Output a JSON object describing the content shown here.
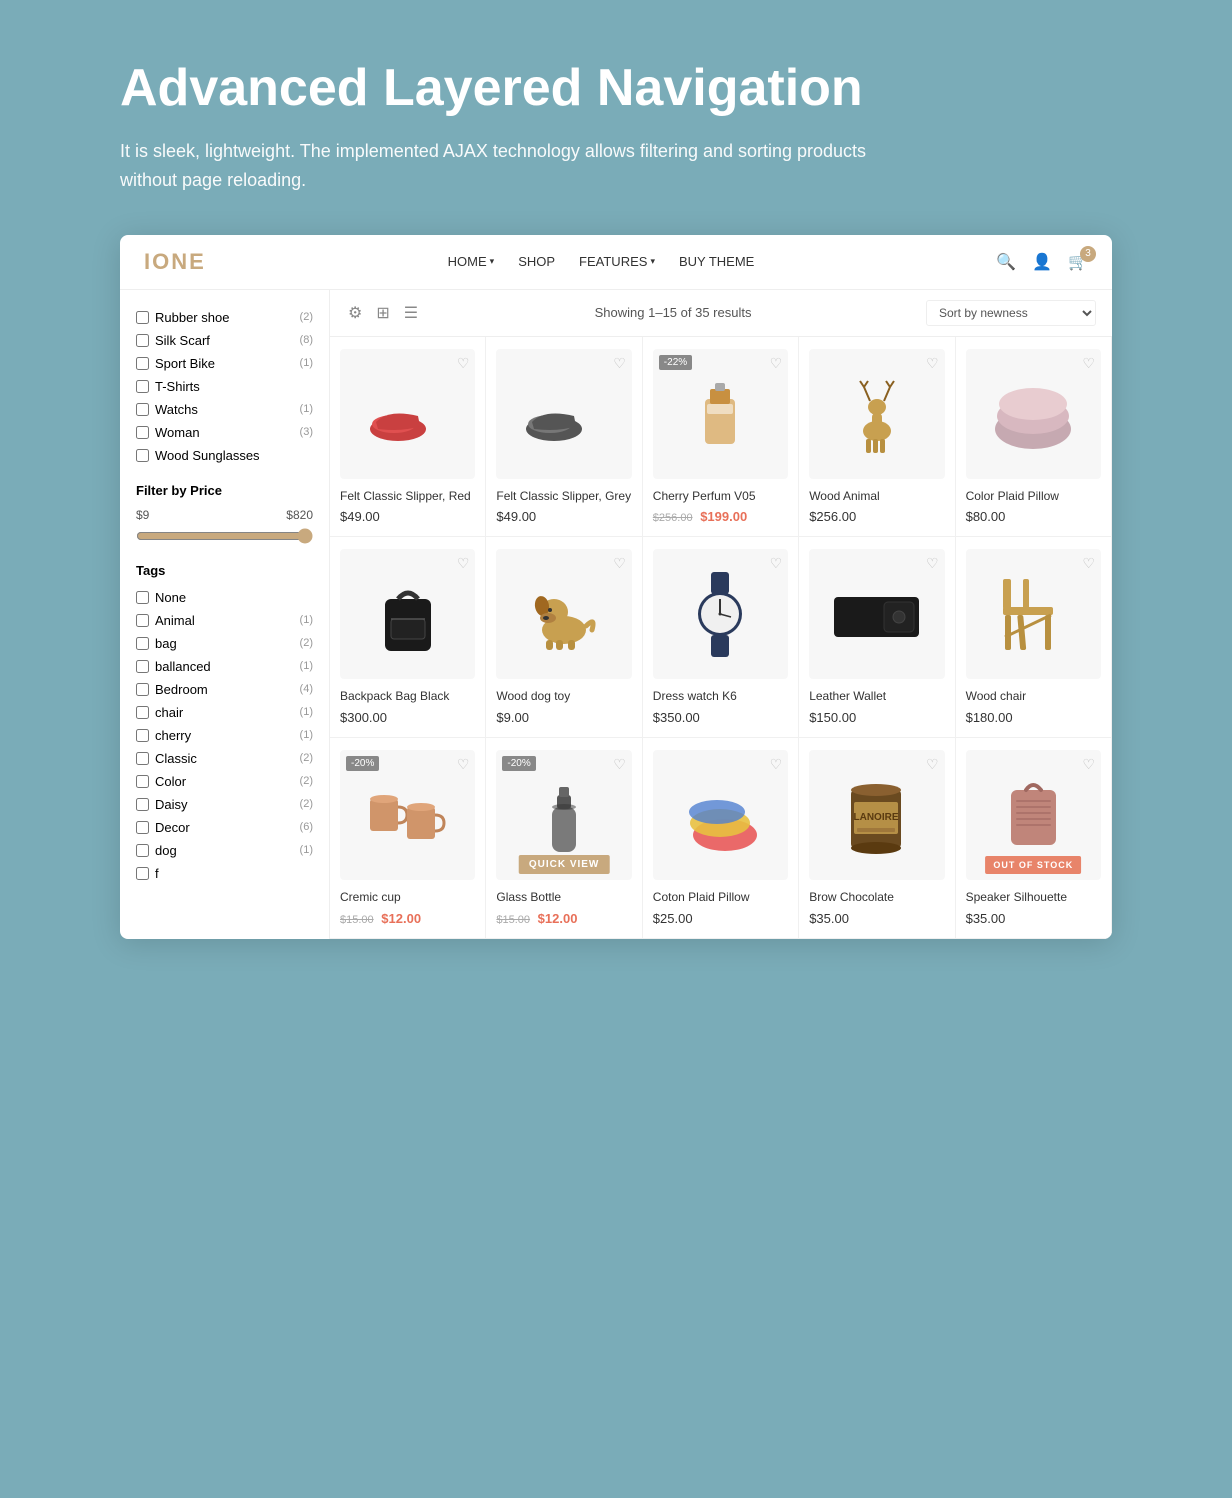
{
  "hero": {
    "title": "Advanced Layered Navigation",
    "description": "It is sleek, lightweight. The implemented AJAX technology allows filtering and sorting products without page reloading."
  },
  "header": {
    "logo": "IONE",
    "nav": [
      {
        "label": "HOME",
        "hasDropdown": true
      },
      {
        "label": "SHOP",
        "hasDropdown": false
      },
      {
        "label": "FEATURES",
        "hasDropdown": true
      },
      {
        "label": "BUY THEME",
        "hasDropdown": false
      }
    ],
    "cart_count": "3"
  },
  "sidebar": {
    "categories": [
      {
        "label": "Rubber shoe",
        "count": "2"
      },
      {
        "label": "Silk Scarf",
        "count": "8"
      },
      {
        "label": "Sport Bike",
        "count": "1"
      },
      {
        "label": "T-Shirts",
        "count": ""
      },
      {
        "label": "Watchs",
        "count": "1"
      },
      {
        "label": "Woman",
        "count": "3"
      },
      {
        "label": "Wood Sunglasses",
        "count": ""
      }
    ],
    "price_filter": {
      "title": "Filter by Price",
      "min": "$9",
      "max": "$820"
    },
    "tags_title": "Tags",
    "tags": [
      {
        "label": "None",
        "count": ""
      },
      {
        "label": "Animal",
        "count": "1"
      },
      {
        "label": "bag",
        "count": "2"
      },
      {
        "label": "ballanced",
        "count": "1"
      },
      {
        "label": "Bedroom",
        "count": "4"
      },
      {
        "label": "chair",
        "count": "1"
      },
      {
        "label": "cherry",
        "count": "1"
      },
      {
        "label": "Classic",
        "count": "2"
      },
      {
        "label": "Color",
        "count": "2"
      },
      {
        "label": "Daisy",
        "count": "2"
      },
      {
        "label": "Decor",
        "count": "6"
      },
      {
        "label": "dog",
        "count": "1"
      },
      {
        "label": "f",
        "count": ""
      }
    ]
  },
  "toolbar": {
    "showing_text": "Showing 1–15 of 35 results",
    "sort_label": "Sort by newness"
  },
  "products": [
    {
      "name": "Felt Classic Slipper, Red",
      "price": "$49.00",
      "original_price": "",
      "sale_price": "",
      "badge": "",
      "out_of_stock": false,
      "quick_view": false,
      "color": "#c94040",
      "shape": "shoe-red"
    },
    {
      "name": "Felt Classic Slipper, Grey",
      "price": "$49.00",
      "original_price": "",
      "sale_price": "",
      "badge": "",
      "out_of_stock": false,
      "quick_view": false,
      "color": "#555",
      "shape": "shoe-grey"
    },
    {
      "name": "Cherry Perfum V05",
      "price": "",
      "original_price": "$256.00",
      "sale_price": "$199.00",
      "badge": "-22%",
      "out_of_stock": false,
      "quick_view": false,
      "color": "#d4a050",
      "shape": "perfume"
    },
    {
      "name": "Wood Animal",
      "price": "$256.00",
      "original_price": "",
      "sale_price": "",
      "badge": "",
      "out_of_stock": false,
      "quick_view": false,
      "color": "#c8a050",
      "shape": "deer"
    },
    {
      "name": "Color Plaid Pillow",
      "price": "$80.00",
      "original_price": "",
      "sale_price": "",
      "badge": "",
      "out_of_stock": false,
      "quick_view": false,
      "color": "#d0aab0",
      "shape": "pillow"
    },
    {
      "name": "Backpack Bag Black",
      "price": "$300.00",
      "original_price": "",
      "sale_price": "",
      "badge": "",
      "out_of_stock": false,
      "quick_view": false,
      "color": "#222",
      "shape": "bag"
    },
    {
      "name": "Wood dog toy",
      "price": "$9.00",
      "original_price": "",
      "sale_price": "",
      "badge": "",
      "out_of_stock": false,
      "quick_view": false,
      "color": "#c8a050",
      "shape": "dog"
    },
    {
      "name": "Dress watch K6",
      "price": "$350.00",
      "original_price": "",
      "sale_price": "",
      "badge": "",
      "out_of_stock": false,
      "quick_view": false,
      "color": "#2a3a5c",
      "shape": "watch"
    },
    {
      "name": "Leather Wallet",
      "price": "$150.00",
      "original_price": "",
      "sale_price": "",
      "badge": "",
      "out_of_stock": false,
      "quick_view": false,
      "color": "#1a1a1a",
      "shape": "wallet"
    },
    {
      "name": "Wood chair",
      "price": "$180.00",
      "original_price": "",
      "sale_price": "",
      "badge": "",
      "out_of_stock": false,
      "quick_view": false,
      "color": "#c8a050",
      "shape": "chair"
    },
    {
      "name": "Cremic cup",
      "price": "",
      "original_price": "$15.00",
      "sale_price": "$12.00",
      "badge": "-20%",
      "out_of_stock": false,
      "quick_view": false,
      "color": "#d0956a",
      "shape": "cup"
    },
    {
      "name": "Glass Bottle",
      "price": "",
      "original_price": "$15.00",
      "sale_price": "$12.00",
      "badge": "-20%",
      "out_of_stock": false,
      "quick_view": true,
      "color": "#333",
      "shape": "bottle"
    },
    {
      "name": "Coton Plaid Pillow",
      "price": "$25.00",
      "original_price": "",
      "sale_price": "",
      "badge": "",
      "out_of_stock": false,
      "quick_view": false,
      "color": "#e8c040",
      "shape": "pillow2"
    },
    {
      "name": "Brow Chocolate",
      "price": "$35.00",
      "original_price": "",
      "sale_price": "",
      "badge": "",
      "out_of_stock": false,
      "quick_view": false,
      "color": "#6a4a20",
      "shape": "chocolate"
    },
    {
      "name": "Speaker Silhouette",
      "price": "$35.00",
      "original_price": "",
      "sale_price": "",
      "badge": "",
      "out_of_stock": true,
      "quick_view": false,
      "color": "#c0857a",
      "shape": "speaker"
    }
  ]
}
